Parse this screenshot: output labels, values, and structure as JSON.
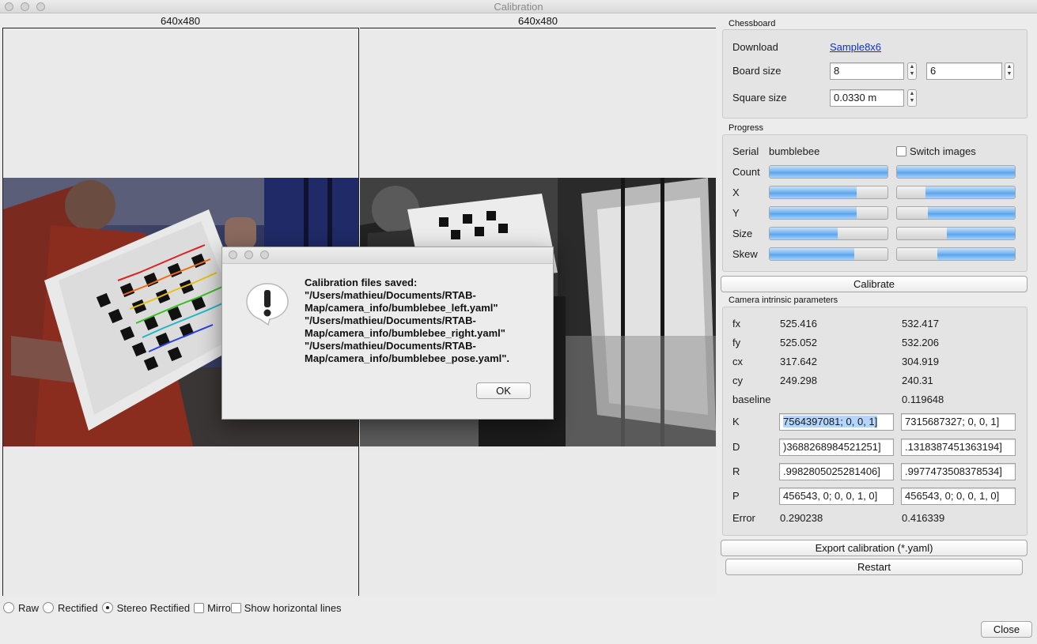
{
  "window": {
    "title": "Calibration"
  },
  "views": {
    "left_size": "640x480",
    "right_size": "640x480"
  },
  "view_options": {
    "raw": "Raw",
    "rectified": "Rectified",
    "stereo_rectified": "Stereo Rectified",
    "mirror": "Mirro",
    "show_horizontal_lines": "Show horizontal lines",
    "selected": "stereo_rectified"
  },
  "chessboard": {
    "title": "Chessboard",
    "download_label": "Download",
    "download_link": "Sample8x6",
    "board_size_label": "Board size",
    "board_width": "8",
    "board_height": "6",
    "square_size_label": "Square size",
    "square_size": "0.0330 m"
  },
  "progress": {
    "title": "Progress",
    "serial_label": "Serial",
    "serial_value": "bumblebee",
    "switch_images": "Switch images",
    "rows": [
      {
        "label": "Count",
        "left": 1.0,
        "right": 1.0
      },
      {
        "label": "X",
        "left": 0.74,
        "right": 0.76
      },
      {
        "label": "Y",
        "left": 0.74,
        "right": 0.74
      },
      {
        "label": "Size",
        "left": 0.58,
        "right": 0.58
      },
      {
        "label": "Skew",
        "left": 0.72,
        "right": 0.66
      }
    ]
  },
  "calibrate_label": "Calibrate",
  "intrinsics": {
    "title": "Camera intrinsic parameters",
    "rows": [
      {
        "label": "fx",
        "left": "525.416",
        "right": "532.417"
      },
      {
        "label": "fy",
        "left": "525.052",
        "right": "532.206"
      },
      {
        "label": "cx",
        "left": "317.642",
        "right": "304.919"
      },
      {
        "label": "cy",
        "left": "249.298",
        "right": "240.31"
      }
    ],
    "baseline_label": "baseline",
    "baseline_value": "0.119648",
    "K_label": "K",
    "K_left": "7564397081;  0, 0, 1]",
    "K_right": "7315687327;  0, 0, 1]",
    "D_label": "D",
    "D_left": ")3688268984521251]",
    "D_right": ".1318387451363194]",
    "R_label": "R",
    "R_left": ".9982805025281406]",
    "R_right": ".9977473508378534]",
    "P_label": "P",
    "P_left": "456543, 0;  0, 0, 1, 0]",
    "P_right": "456543, 0;  0, 0, 1, 0]",
    "error_label": "Error",
    "error_left": "0.290238",
    "error_right": "0.416339"
  },
  "export_label": "Export calibration (*.yaml)",
  "restart_label": "Restart",
  "close_label": "Close",
  "dialog": {
    "lines": [
      "Calibration files saved:",
      "  \"/Users/mathieu/Documents/RTAB-",
      "Map/camera_info/bumblebee_left.yaml\"",
      "  \"/Users/mathieu/Documents/RTAB-",
      "Map/camera_info/bumblebee_right.yaml\"",
      "  \"/Users/mathieu/Documents/RTAB-",
      "Map/camera_info/bumblebee_pose.yaml\"."
    ],
    "ok_label": "OK",
    "icon": "exclamation-alert-icon"
  }
}
